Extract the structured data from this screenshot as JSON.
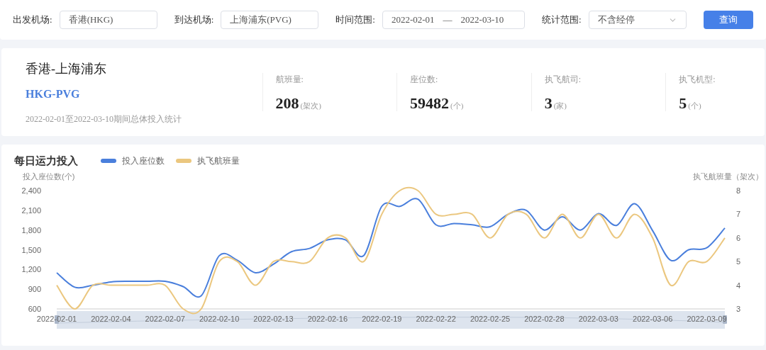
{
  "filters": [
    {
      "kind": "text",
      "label": "出发机场:",
      "value": "香港(HKG)"
    },
    {
      "kind": "text",
      "label": "到达机场:",
      "value": "上海浦东(PVG)"
    },
    {
      "kind": "daterange",
      "label": "时间范围:",
      "start": "2022-02-01",
      "separator": "—",
      "end": "2022-03-10"
    },
    {
      "kind": "select",
      "label": "统计范围:",
      "value": "不含经停"
    }
  ],
  "query_button": "查询",
  "summary": {
    "route_name": "香港-上海浦东",
    "route_code": "HKG-PVG",
    "period_note": "2022-02-01至2022-03-10期间总体投入统计",
    "stats": [
      {
        "label": "航班量:",
        "value": "208",
        "unit": "(架次)"
      },
      {
        "label": "座位数:",
        "value": "59482",
        "unit": "(个)"
      },
      {
        "label": "执飞航司:",
        "value": "3",
        "unit": "(家)"
      },
      {
        "label": "执飞机型:",
        "value": "5",
        "unit": "(个)"
      }
    ]
  },
  "chart": {
    "chart_data": {
      "type": "line",
      "title": "每日运力投入",
      "ylabel": "投入座位数(个)",
      "y2label": "执飞航班量（架次）",
      "categories": [
        "2022-02-01",
        null,
        null,
        "2022-02-04",
        null,
        null,
        "2022-02-07",
        null,
        null,
        "2022-02-10",
        null,
        null,
        "2022-02-13",
        null,
        null,
        "2022-02-16",
        null,
        null,
        "2022-02-19",
        null,
        null,
        "2022-02-22",
        null,
        null,
        "2022-02-25",
        null,
        null,
        "2022-02-28",
        null,
        null,
        "2022-03-03",
        null,
        null,
        "2022-03-06",
        null,
        null,
        "2022-03-09",
        null
      ],
      "ylim": [
        600,
        2400
      ],
      "yticks": [
        {
          "value": 600,
          "label": "600"
        },
        {
          "value": 900,
          "label": "900"
        },
        {
          "value": 1200,
          "label": "1,200"
        },
        {
          "value": 1500,
          "label": "1,500"
        },
        {
          "value": 1800,
          "label": "1,800"
        },
        {
          "value": 2100,
          "label": "2,100"
        },
        {
          "value": 2400,
          "label": "2,400"
        }
      ],
      "y2lim": [
        3,
        8
      ],
      "y2ticks": [
        3,
        4,
        5,
        6,
        7,
        8
      ],
      "series": [
        {
          "name": "投入座位数",
          "color": "#4a7fdc",
          "values": [
            1150,
            930,
            960,
            1010,
            1020,
            1020,
            1020,
            940,
            800,
            1410,
            1340,
            1150,
            1280,
            1470,
            1520,
            1650,
            1650,
            1410,
            2160,
            2160,
            2270,
            1880,
            1900,
            1880,
            1850,
            2040,
            2100,
            1800,
            2000,
            1800,
            2050,
            1870,
            2200,
            1790,
            1340,
            1500,
            1530,
            1830
          ]
        },
        {
          "name": "执飞航班量",
          "color": "#ebc77f",
          "axis": "y2",
          "values": [
            4,
            3,
            4,
            4,
            4,
            4,
            4,
            3,
            3,
            5,
            5,
            4,
            5,
            5,
            5,
            6,
            6,
            5,
            7,
            8,
            8,
            7,
            7,
            7,
            6,
            7,
            7,
            6,
            7,
            6,
            7,
            6,
            7,
            6,
            4,
            5,
            5,
            6
          ]
        }
      ]
    }
  }
}
